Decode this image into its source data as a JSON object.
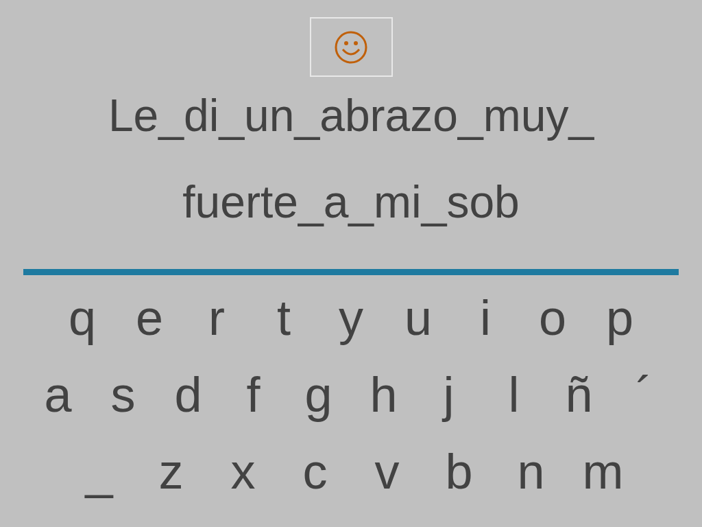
{
  "sentence_lines": [
    "Le_di_un_abrazo_muy_",
    "fuerte_a_mi_sob"
  ],
  "keyboard_rows": [
    [
      "q",
      "e",
      "r",
      "t",
      "y",
      "u",
      "i",
      "o",
      "p"
    ],
    [
      "a",
      "s",
      "d",
      "f",
      "g",
      "h",
      "j",
      "l",
      "ñ",
      "´"
    ],
    [
      "_",
      "z",
      "x",
      "c",
      "v",
      "b",
      "n",
      "m"
    ]
  ]
}
